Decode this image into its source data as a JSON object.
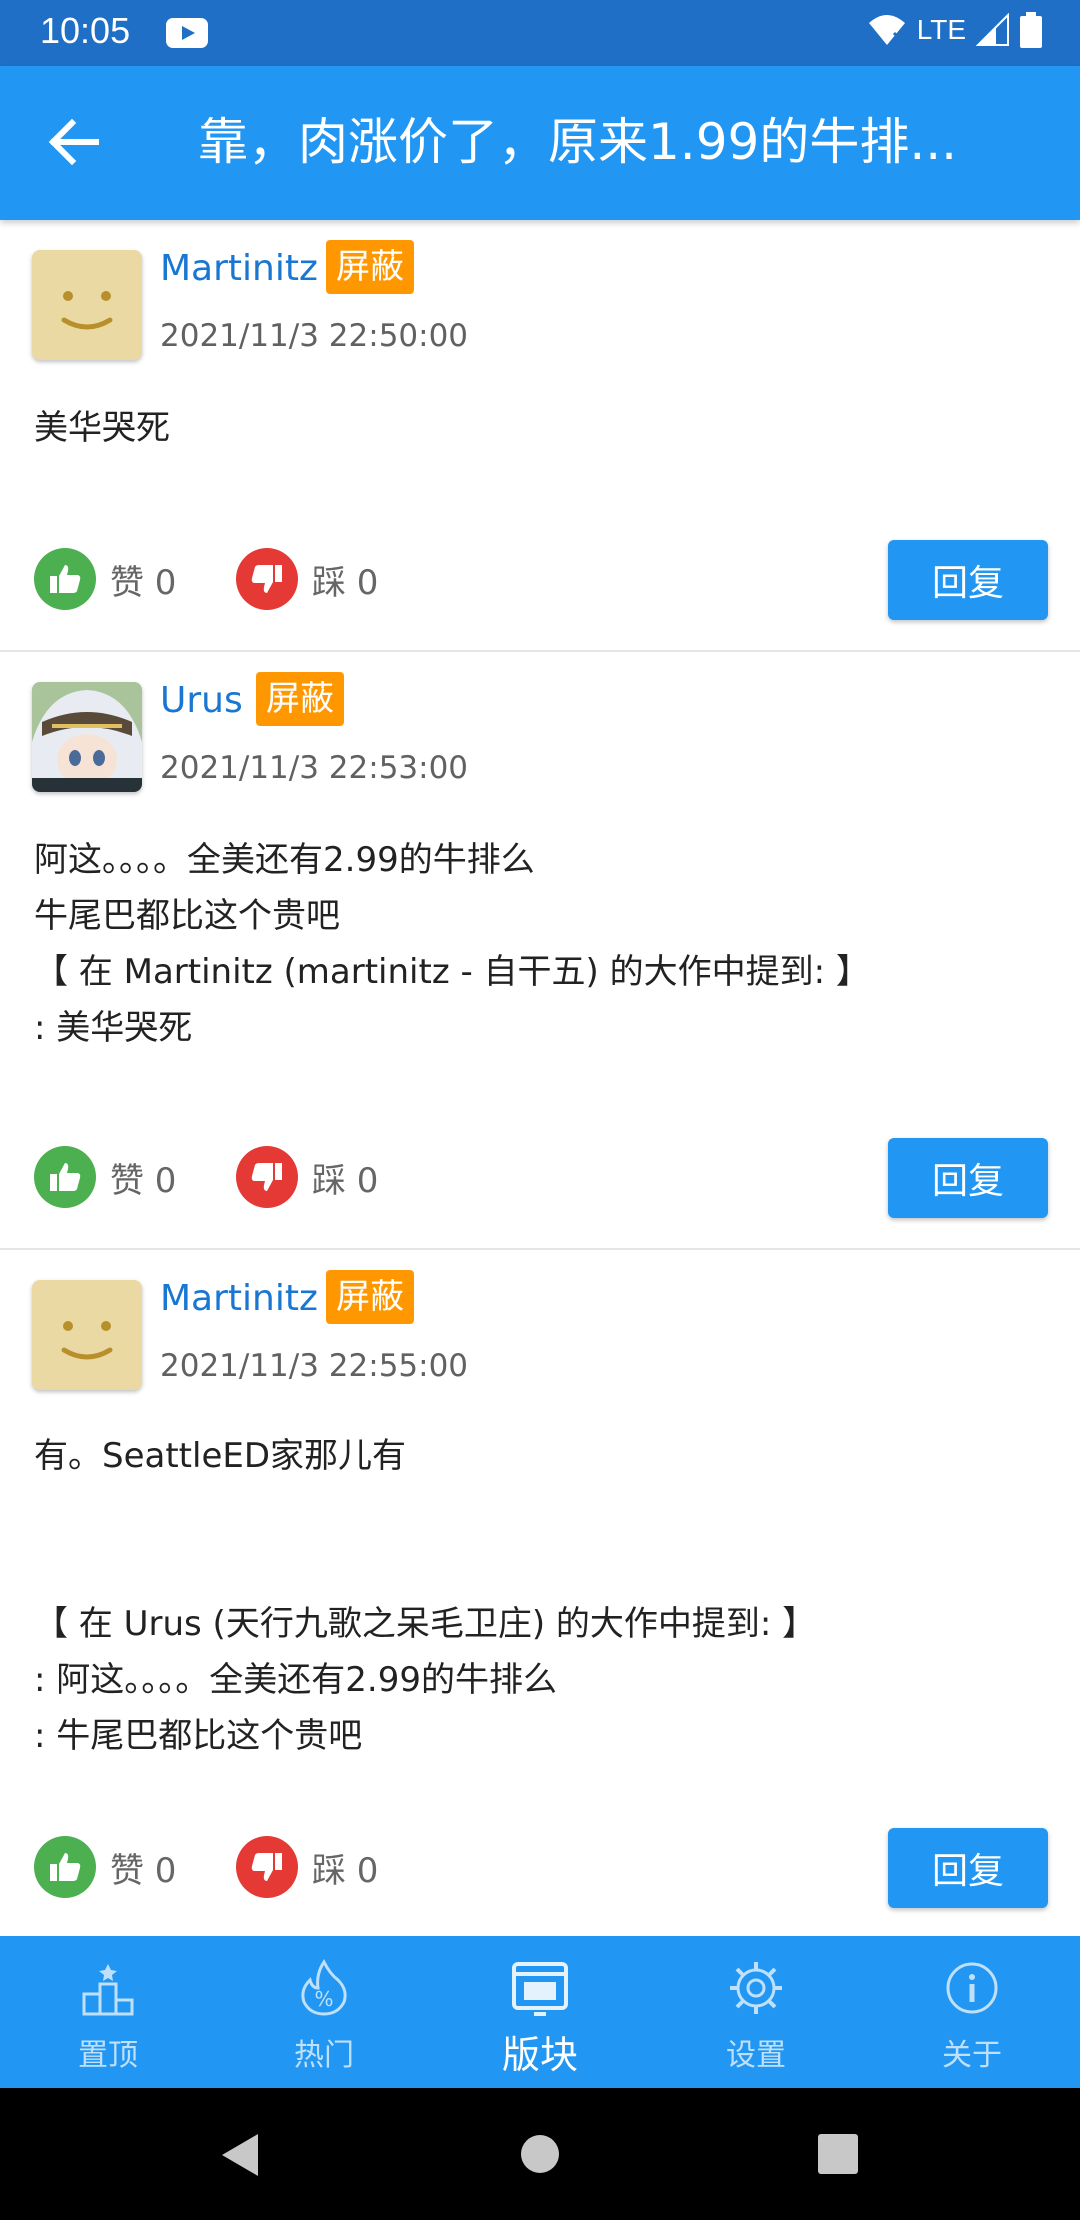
{
  "status_bar": {
    "time": "10:05",
    "network": "LTE",
    "icons": [
      "youtube-icon",
      "wifi-icon",
      "signal-icon",
      "battery-icon"
    ]
  },
  "app_bar": {
    "back_icon": "arrow-left-icon",
    "title": "靠，肉涨价了，原来1.99的牛排..."
  },
  "posts": [
    {
      "username": "Martinitz",
      "badge": "屏蔽",
      "timestamp": "2021/11/3 22:50:00",
      "content": "美华哭死",
      "like_label": "赞 0",
      "dislike_label": "踩 0",
      "reply_label": "回复"
    },
    {
      "username": "Urus",
      "badge": "屏蔽",
      "timestamp": "2021/11/3 22:53:00",
      "content": "阿这。。。。全美还有2.99的牛排么\n牛尾巴都比这个贵吧\n【 在 Martinitz (martinitz - 自干五) 的大作中提到: 】\n: 美华哭死",
      "like_label": "赞 0",
      "dislike_label": "踩 0",
      "reply_label": "回复"
    },
    {
      "username": "Martinitz",
      "badge": "屏蔽",
      "timestamp": "2021/11/3 22:55:00",
      "content": "有。SeattleED家那儿有\n\n\n【 在 Urus (天行九歌之呆毛卫庄) 的大作中提到: 】\n: 阿这。。。。全美还有2.99的牛排么\n: 牛尾巴都比这个贵吧",
      "like_label": "赞 0",
      "dislike_label": "踩 0",
      "reply_label": "回复"
    }
  ],
  "bottom_nav": {
    "items": [
      {
        "label": "置顶",
        "icon": "podium-icon"
      },
      {
        "label": "热门",
        "icon": "fire-icon"
      },
      {
        "label": "版块",
        "icon": "board-icon",
        "active": true
      },
      {
        "label": "设置",
        "icon": "gear-icon"
      },
      {
        "label": "关于",
        "icon": "info-icon"
      }
    ]
  },
  "colors": {
    "status_bar": "#1f6fc6",
    "primary": "#2196f3",
    "username": "#1976d2",
    "badge": "#ff9800",
    "like": "#4caf50",
    "dislike": "#e53935"
  }
}
